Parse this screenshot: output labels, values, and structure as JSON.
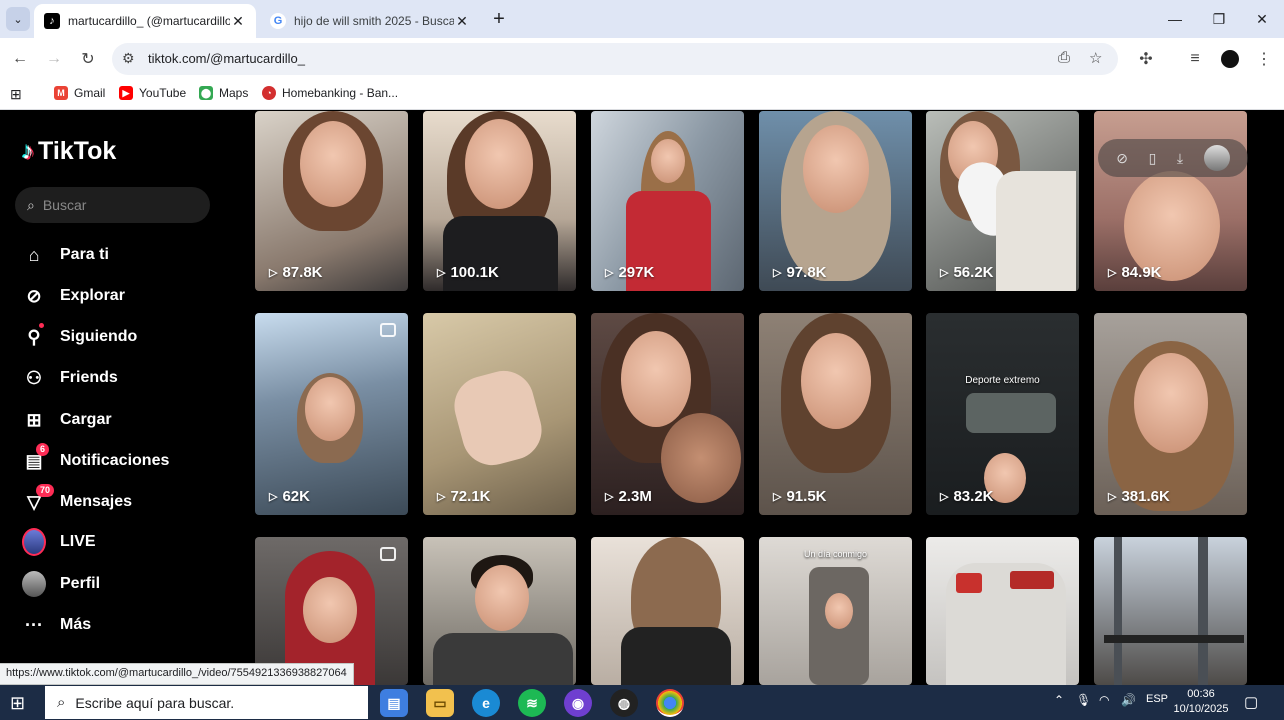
{
  "browser": {
    "tabs": [
      {
        "title": "martucardillo_ (@martucardillo",
        "active": true,
        "favicon": "tiktok-icon"
      },
      {
        "title": "hijo de will smith 2025 - Buscar",
        "active": false,
        "favicon": "google-icon"
      }
    ],
    "url": "tiktok.com/@martucardillo_",
    "bookmarks": [
      {
        "label": "Gmail",
        "icon": "gmail-icon"
      },
      {
        "label": "YouTube",
        "icon": "youtube-icon"
      },
      {
        "label": "Maps",
        "icon": "maps-icon"
      },
      {
        "label": "Homebanking - Ban...",
        "icon": "bank-icon"
      }
    ],
    "status_url": "https://www.tiktok.com/@martucardillo_/video/7554921336938827064"
  },
  "sidebar": {
    "logo": "TikTok",
    "search_placeholder": "Buscar",
    "items": [
      {
        "label": "Para ti",
        "icon": "home-icon"
      },
      {
        "label": "Explorar",
        "icon": "compass-icon"
      },
      {
        "label": "Siguiendo",
        "icon": "following-icon"
      },
      {
        "label": "Friends",
        "icon": "friends-icon"
      },
      {
        "label": "Cargar",
        "icon": "upload-icon"
      },
      {
        "label": "Notificaciones",
        "icon": "inbox-icon",
        "badge": "6"
      },
      {
        "label": "Mensajes",
        "icon": "send-icon",
        "badge": "70"
      },
      {
        "label": "LIVE",
        "icon": "live-avatar-icon"
      },
      {
        "label": "Perfil",
        "icon": "profile-avatar-icon"
      },
      {
        "label": "Más",
        "icon": "more-icon"
      }
    ]
  },
  "videos": [
    {
      "views": "87.8K",
      "caption": ""
    },
    {
      "views": "100.1K",
      "caption": ""
    },
    {
      "views": "297K",
      "caption": ""
    },
    {
      "views": "97.8K",
      "caption": ""
    },
    {
      "views": "56.2K",
      "caption": ""
    },
    {
      "views": "84.9K",
      "caption": ""
    },
    {
      "views": "62K",
      "caption": ""
    },
    {
      "views": "72.1K",
      "caption": ""
    },
    {
      "views": "2.3M",
      "caption": ""
    },
    {
      "views": "91.5K",
      "caption": ""
    },
    {
      "views": "83.2K",
      "caption": "Deporte extremo"
    },
    {
      "views": "381.6K",
      "caption": ""
    },
    {
      "views": "",
      "caption": ""
    },
    {
      "views": "",
      "caption": ""
    },
    {
      "views": "",
      "caption": ""
    },
    {
      "views": "",
      "caption": "Un día conmigo"
    },
    {
      "views": "",
      "caption": ""
    },
    {
      "views": "",
      "caption": ""
    }
  ],
  "taskbar": {
    "search_placeholder": "Escribe aquí para buscar.",
    "language": "ESP",
    "time": "00:36",
    "date": "10/10/2025"
  },
  "colors": {
    "accent": "#fe2c55",
    "cyan": "#25f4ee",
    "taskbar": "#1c2c45"
  }
}
